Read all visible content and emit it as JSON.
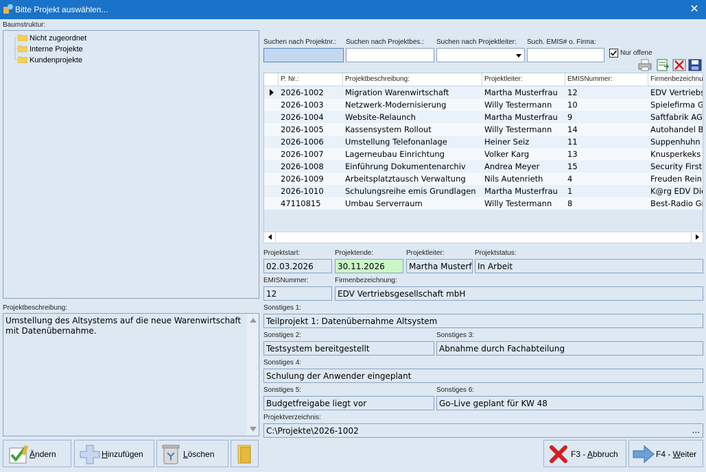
{
  "window": {
    "title": "Bitte Projekt auswählen...",
    "close_glyph": "✕"
  },
  "tree": {
    "label": "Baumstruktur:",
    "items": [
      {
        "label": "Nicht zugeordnet",
        "icon": "folder-icon"
      },
      {
        "label": "Interne Projekte",
        "icon": "folder-icon"
      },
      {
        "label": "Kundenprojekte",
        "icon": "folder-icon"
      }
    ]
  },
  "search": {
    "projektnr_label": "Suchen nach Projektnr.:",
    "projektbes_label": "Suchen nach Projektbes.:",
    "projektleiter_label": "Suchen nach Projektleiter:",
    "emis_label": "Such. EMIS# o. Firma:",
    "projektnr_value": "",
    "projektbes_value": "",
    "projektleiter_value": "",
    "emis_value": "",
    "nur_offene_label": "Nur offene",
    "nur_offene_checked": true
  },
  "grid": {
    "columns": [
      "P. Nr.:",
      "Projektbeschreibung:",
      "Projektleiter:",
      "EMISNummer:",
      "Firmenbezeichnung:"
    ],
    "rows": [
      {
        "nr": "2026-1002",
        "beschreibung": "Migration Warenwirtschaft",
        "leiter": "Martha Musterfrau",
        "emis": "12",
        "firma": "EDV Vertriebsgesellschaft mbH",
        "selected": true
      },
      {
        "nr": "2026-1003",
        "beschreibung": "Netzwerk-Modernisierung",
        "leiter": "Willy Testermann",
        "emis": "10",
        "firma": "Spielefirma GmbH"
      },
      {
        "nr": "2026-1004",
        "beschreibung": "Website-Relaunch",
        "leiter": "Martha Musterfrau",
        "emis": "9",
        "firma": "Saftfabrik AG"
      },
      {
        "nr": "2026-1005",
        "beschreibung": "Kassensystem Rollout",
        "leiter": "Willy Testermann",
        "emis": "14",
        "firma": "Autohandel Bauer"
      },
      {
        "nr": "2026-1006",
        "beschreibung": "Umstellung Telefonanlage",
        "leiter": "Heiner Seiz",
        "emis": "11",
        "firma": "Suppenhuhn GmbH"
      },
      {
        "nr": "2026-1007",
        "beschreibung": "Lagerneubau Einrichtung",
        "leiter": "Volker Karg",
        "emis": "13",
        "firma": "Knusperkeks GmbH"
      },
      {
        "nr": "2026-1008",
        "beschreibung": "Einführung Dokumentenarchiv",
        "leiter": "Andrea Meyer",
        "emis": "15",
        "firma": "Security First AG"
      },
      {
        "nr": "2026-1009",
        "beschreibung": "Arbeitsplatztausch Verwaltung",
        "leiter": "Nils Autenrieth",
        "emis": "4",
        "firma": "Freuden Reinigung"
      },
      {
        "nr": "2026-1010",
        "beschreibung": "Schulungsreihe emis Grundlagen",
        "leiter": "Martha Musterfrau",
        "emis": "1",
        "firma": "K@rg EDV Dienste"
      },
      {
        "nr": "47110815",
        "beschreibung": "Umbau Serverraum",
        "leiter": "Willy Testermann",
        "emis": "8",
        "firma": "Best-Radio GmbH"
      }
    ]
  },
  "details": {
    "projektstart_label": "Projektstart:",
    "projektstart": "02.03.2026",
    "projektende_label": "Projektende:",
    "projektende": "30.11.2026",
    "projektleiter_label": "Projektleiter:",
    "projektleiter": "Martha Musterfrau",
    "projektstatus_label": "Projektstatus:",
    "projektstatus": "In Arbeit",
    "emis_label": "EMISNummer:",
    "emis": "12",
    "firma_label": "Firmenbezeichnung:",
    "firma": "EDV Vertriebsgesellschaft mbH",
    "s1_label": "Sonstiges 1:",
    "s1": "Teilprojekt 1: Datenübernahme Altsystem",
    "s2_label": "Sonstiges 2:",
    "s2": "Testsystem bereitgestellt",
    "s3_label": "Sonstiges 3:",
    "s3": "Abnahme durch Fachabteilung",
    "s4_label": "Sonstiges 4:",
    "s4": "Schulung der Anwender eingeplant",
    "s5_label": "Sonstiges 5:",
    "s5": "Budgetfreigabe liegt vor",
    "s6_label": "Sonstiges 6:",
    "s6": "Go-Live geplant für KW 48",
    "verzeichnis_label": "Projektverzeichnis:",
    "verzeichnis": "C:\\Projekte\\2026-1002",
    "browse": "..."
  },
  "beschreibung": {
    "label": "Projektbeschreibung:",
    "text": "Umstellung des Altsystems auf die neue Warenwirtschaft mit Datenübernahme."
  },
  "buttons": {
    "aendern": "Ändern",
    "hinzufuegen": "Hinzufügen",
    "loeschen": "Löschen",
    "abbruch": "F3 - Abbruch",
    "weiter": "F4 - Weiter"
  },
  "colors": {
    "titlebar": "#1a72c9",
    "highlight_field": "#ccf5c8",
    "selected_input": "#c3d9f2"
  }
}
